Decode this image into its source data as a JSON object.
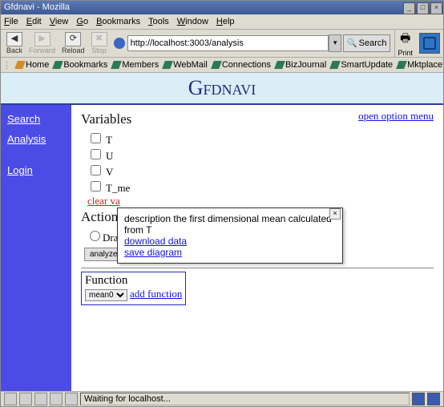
{
  "title": "Gfdnavi - Mozilla",
  "menu": [
    "File",
    "Edit",
    "View",
    "Go",
    "Bookmarks",
    "Tools",
    "Window",
    "Help"
  ],
  "toolbar": {
    "back": "Back",
    "forward": "Forward",
    "reload": "Reload",
    "stop": "Stop",
    "search": "Search",
    "print": "Print"
  },
  "url": "http://localhost:3003/analysis",
  "links": [
    "Home",
    "Bookmarks",
    "Members",
    "WebMail",
    "Connections",
    "BizJournal",
    "SmartUpdate",
    "Mktplace"
  ],
  "app_title": "Gfdnavi",
  "sidebar": {
    "search": "Search",
    "analysis": "Analysis",
    "login": "Login"
  },
  "open_option": "open option menu",
  "variables": {
    "heading": "Variables",
    "items": [
      "T",
      "U",
      "V",
      "T_me"
    ],
    "clear": "clear va"
  },
  "action": {
    "heading": "Action",
    "draw": "Draw",
    "analyze": "analyze"
  },
  "function": {
    "heading": "Function",
    "selected": "mean0",
    "add": "add function"
  },
  "tooltip": {
    "desc": "description the first dimensional mean calculated from T",
    "download": "download data",
    "save": "save diagram"
  },
  "status": "Waiting for localhost..."
}
